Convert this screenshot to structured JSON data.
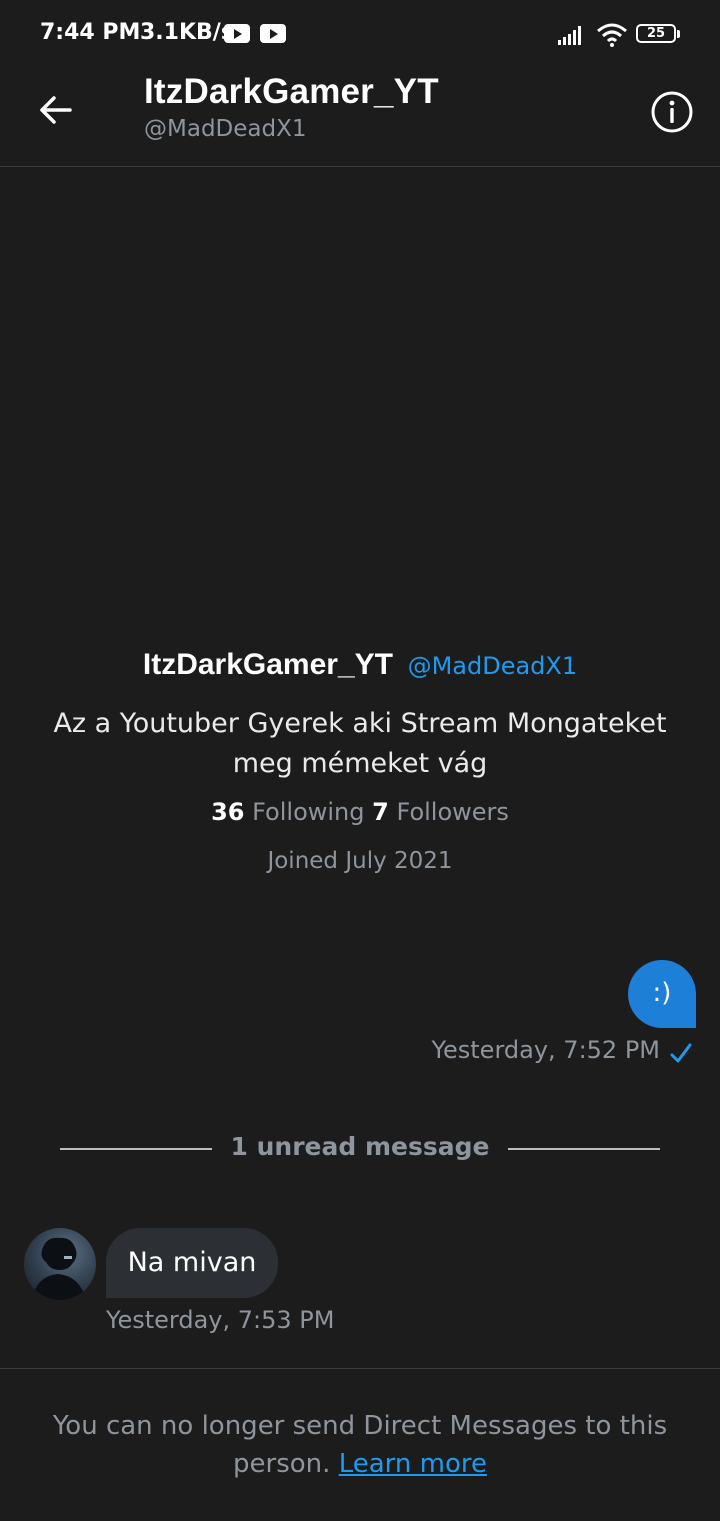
{
  "status_bar": {
    "time": "7:44 PM",
    "network_speed": "3.1KB/s",
    "battery": "25"
  },
  "header": {
    "name": "ItzDarkGamer_YT",
    "handle": "@MadDeadX1"
  },
  "profile": {
    "name": "ItzDarkGamer_YT",
    "handle": "@MadDeadX1",
    "bio": "Az a Youtuber Gyerek aki Stream Mongateket meg mémeket vág",
    "following_count": "36",
    "following_label": "Following",
    "followers_count": "7",
    "followers_label": "Followers",
    "joined": "Joined July 2021"
  },
  "messages": {
    "sent": {
      "text": ":)",
      "time": "Yesterday, 7:52 PM"
    },
    "unread_divider": "1 unread message",
    "received": {
      "text": "Na mivan",
      "time": "Yesterday, 7:53 PM"
    }
  },
  "footer": {
    "notice": "You can no longer send Direct Messages to this person.",
    "link": "Learn more"
  },
  "colors": {
    "background": "#1c1c1c",
    "accent": "#1d9bf0",
    "sent_bubble": "#1d7fd8",
    "received_bubble": "#2c2f33",
    "muted_text": "#8e959c"
  },
  "icons": {
    "back": "arrow-left-icon",
    "info": "info-circle-icon",
    "read": "checkmark-icon"
  }
}
